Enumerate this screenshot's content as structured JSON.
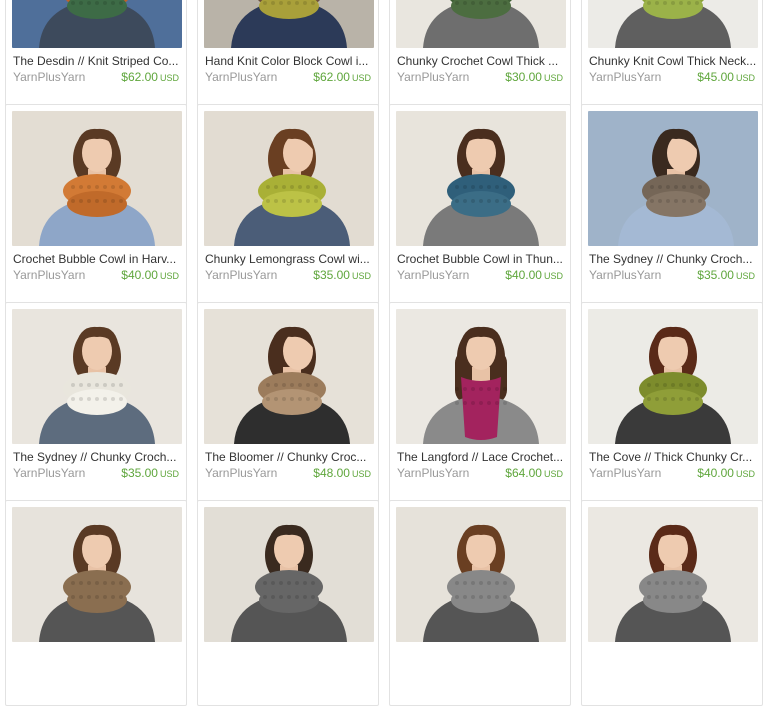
{
  "listings": [
    {
      "title": "The Desdin // Knit Striped Co...",
      "shop": "YarnPlusYarn",
      "price": "$62.00",
      "currency": "USD",
      "bg": "#4f6f9a",
      "scarf": "#c0612b",
      "scarf2": "#3d6b46",
      "hair": "#3a2a1f",
      "top": "#3d4a5c",
      "pose": "front"
    },
    {
      "title": "Hand Knit Color Block Cowl i...",
      "shop": "YarnPlusYarn",
      "price": "$62.00",
      "currency": "USD",
      "bg": "#b9b3a8",
      "scarf": "#6b4f3c",
      "scarf2": "#a9a03a",
      "hair": "#3a2a1f",
      "top": "#2c3a58",
      "pose": "front"
    },
    {
      "title": "Chunky Crochet Cowl Thick ...",
      "shop": "YarnPlusYarn",
      "price": "$30.00",
      "currency": "USD",
      "bg": "#e9e6df",
      "scarf": "#3f5f36",
      "scarf2": "#4c6d40",
      "hair": "#3a2a1f",
      "top": "#6e6e6e",
      "pose": "front"
    },
    {
      "title": "Chunky Knit Cowl Thick Neck...",
      "shop": "YarnPlusYarn",
      "price": "$45.00",
      "currency": "USD",
      "bg": "#ecebe7",
      "scarf": "#8aa23a",
      "scarf2": "#9bb249",
      "hair": "#3a2a1f",
      "top": "#5f5f5f",
      "pose": "front"
    },
    {
      "title": "Crochet Bubble Cowl in Harv...",
      "shop": "YarnPlusYarn",
      "price": "$40.00",
      "currency": "USD",
      "bg": "#e3ddd3",
      "scarf": "#d27a35",
      "scarf2": "#c06a2a",
      "hair": "#5a3a24",
      "top": "#8ea6c8",
      "pose": "front"
    },
    {
      "title": "Chunky Lemongrass Cowl wi...",
      "shop": "YarnPlusYarn",
      "price": "$35.00",
      "currency": "USD",
      "bg": "#e2dcd2",
      "scarf": "#a9b036",
      "scarf2": "#bcc246",
      "hair": "#6a3f22",
      "top": "#4b5d78",
      "pose": "side"
    },
    {
      "title": "Crochet Bubble Cowl in Thun...",
      "shop": "YarnPlusYarn",
      "price": "$40.00",
      "currency": "USD",
      "bg": "#e8e4dc",
      "scarf": "#2f5f7a",
      "scarf2": "#3b6d86",
      "hair": "#4a2e1e",
      "top": "#7a7a7a",
      "pose": "front"
    },
    {
      "title": "The Sydney // Chunky Croch...",
      "shop": "YarnPlusYarn",
      "price": "$35.00",
      "currency": "USD",
      "bg": "#9fb3c9",
      "scarf": "#756657",
      "scarf2": "#857565",
      "hair": "#3a2a1f",
      "top": "#a4b9d4",
      "pose": "side"
    },
    {
      "title": "The Sydney // Chunky Croch...",
      "shop": "YarnPlusYarn",
      "price": "$35.00",
      "currency": "USD",
      "bg": "#e9e5de",
      "scarf": "#e9e6dd",
      "scarf2": "#f3f1ea",
      "hair": "#5a3a24",
      "top": "#5d6c7e",
      "pose": "front"
    },
    {
      "title": "The Bloomer // Chunky Croc...",
      "shop": "YarnPlusYarn",
      "price": "$48.00",
      "currency": "USD",
      "bg": "#e6e1d8",
      "scarf": "#9c7c5c",
      "scarf2": "#b39474",
      "hair": "#4a2e1e",
      "top": "#2e2e2e",
      "pose": "side"
    },
    {
      "title": "The Langford // Lace Crochet...",
      "shop": "YarnPlusYarn",
      "price": "$64.00",
      "currency": "USD",
      "bg": "#ebe8e2",
      "scarf": "#a3235e",
      "scarf2": "#b52e6b",
      "hair": "#4a2e1e",
      "top": "#8a8a8a",
      "pose": "long"
    },
    {
      "title": "The Cove // Thick Chunky Cr...",
      "shop": "YarnPlusYarn",
      "price": "$40.00",
      "currency": "USD",
      "bg": "#ecebe6",
      "scarf": "#7d8c2c",
      "scarf2": "#8f9e38",
      "hair": "#5a2a18",
      "top": "#3a3a3a",
      "pose": "front"
    },
    {
      "title": "",
      "shop": "",
      "price": "",
      "currency": "",
      "bg": "#e7e3dc",
      "scarf": "#8a6e50",
      "scarf2": "#8a6e50",
      "hair": "#5a3a24",
      "top": "#555555",
      "pose": "front"
    },
    {
      "title": "",
      "shop": "",
      "price": "",
      "currency": "",
      "bg": "#e2ded6",
      "scarf": "#666666",
      "scarf2": "#666666",
      "hair": "#3a2a1f",
      "top": "#555555",
      "pose": "front"
    },
    {
      "title": "",
      "shop": "",
      "price": "",
      "currency": "",
      "bg": "#e6e2da",
      "scarf": "#888888",
      "scarf2": "#888888",
      "hair": "#6a3f22",
      "top": "#555555",
      "pose": "front"
    },
    {
      "title": "",
      "shop": "",
      "price": "",
      "currency": "",
      "bg": "#ebe8e2",
      "scarf": "#888888",
      "scarf2": "#888888",
      "hair": "#5a2a18",
      "top": "#555555",
      "pose": "front"
    }
  ]
}
